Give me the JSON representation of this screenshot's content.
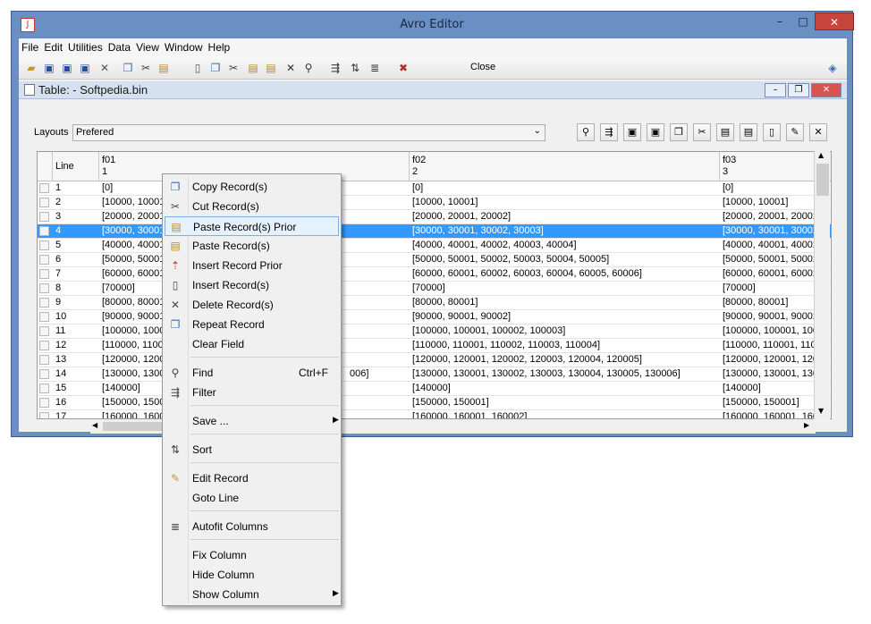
{
  "window": {
    "title": "Avro Editor"
  },
  "menu": [
    "File",
    "Edit",
    "Utilities",
    "Data",
    "View",
    "Window",
    "Help"
  ],
  "toolbar": {
    "close_label": "Close"
  },
  "inner": {
    "title": "Table: - Softpedia.bin"
  },
  "layouts": {
    "label": "Layouts",
    "value": "Prefered"
  },
  "table": {
    "line_header": "Line",
    "columns": [
      {
        "name": "f01",
        "index": "1"
      },
      {
        "name": "f02",
        "index": "2"
      },
      {
        "name": "f03",
        "index": "3"
      }
    ],
    "rows": [
      {
        "line": "1",
        "f01": "[0]",
        "f02": "[0]",
        "f03": "[0]"
      },
      {
        "line": "2",
        "f01": "[10000, 10001]",
        "f02": "[10000, 10001]",
        "f03": "[10000, 10001]"
      },
      {
        "line": "3",
        "f01": "[20000, 20001, 2",
        "f02": "[20000, 20001, 20002]",
        "f03": "[20000, 20001, 20002]"
      },
      {
        "line": "4",
        "f01": "[30000, 30001, 3",
        "f02": "[30000, 30001, 30002, 30003]",
        "f03": "[30000, 30001, 30002,",
        "selected": true
      },
      {
        "line": "5",
        "f01": "[40000, 40001, 4",
        "f02": "[40000, 40001, 40002, 40003, 40004]",
        "f03": "[40000, 40001, 40002,"
      },
      {
        "line": "6",
        "f01": "[50000, 50001, 5",
        "f02": "[50000, 50001, 50002, 50003, 50004, 50005]",
        "f03": "[50000, 50001, 50002,"
      },
      {
        "line": "7",
        "f01": "[60000, 60001, 6",
        "f02": "[60000, 60001, 60002, 60003, 60004, 60005, 60006]",
        "f03": "[60000, 60001, 60002, 6"
      },
      {
        "line": "8",
        "f01": "[70000]",
        "f02": "[70000]",
        "f03": "[70000]"
      },
      {
        "line": "9",
        "f01": "[80000, 80001]",
        "f02": "[80000, 80001]",
        "f03": "[80000, 80001]"
      },
      {
        "line": "10",
        "f01": "[90000, 90001, 9",
        "f02": "[90000, 90001, 90002]",
        "f03": "[90000, 90001, 90002]"
      },
      {
        "line": "11",
        "f01": "[100000, 100001",
        "f02": "[100000, 100001, 100002, 100003]",
        "f03": "[100000, 100001, 10000"
      },
      {
        "line": "12",
        "f01": "[110000, 110001",
        "f02": "[110000, 110001, 110002, 110003, 110004]",
        "f03": "[110000, 110001, 11000"
      },
      {
        "line": "13",
        "f01": "[120000, 120001",
        "f02": "[120000, 120001, 120002, 120003, 120004, 120005]",
        "f03": "[120000, 120001, 12000"
      },
      {
        "line": "14",
        "f01": "[130000, 130001",
        "f01_tail": "006]",
        "f02": "[130000, 130001, 130002, 130003, 130004, 130005, 130006]",
        "f03": "[130000, 130001, 13000"
      },
      {
        "line": "15",
        "f01": "[140000]",
        "f02": "[140000]",
        "f03": "[140000]"
      },
      {
        "line": "16",
        "f01": "[150000, 150001",
        "f02": "[150000, 150001]",
        "f03": "[150000, 150001]"
      },
      {
        "line": "17",
        "f01": "[160000, 160001",
        "f02": "[160000, 160001, 160002]",
        "f03": "[160000, 160001, 16000"
      }
    ]
  },
  "context_menu": {
    "copy": "Copy Record(s)",
    "cut": "Cut Record(s)",
    "paste_prior": "Paste Record(s) Prior",
    "paste": "Paste Record(s)",
    "insert_prior": "Insert Record Prior",
    "insert": "Insert Record(s)",
    "delete": "Delete Record(s)",
    "repeat": "Repeat Record",
    "clear": "Clear Field",
    "find": "Find",
    "find_shortcut": "Ctrl+F",
    "filter": "Filter",
    "save": "Save ...",
    "sort": "Sort",
    "edit": "Edit Record",
    "goto": "Goto Line",
    "autofit": "Autofit Columns",
    "fix": "Fix Column",
    "hide": "Hide Column",
    "show": "Show Column"
  },
  "colors": {
    "selection": "#3399ff",
    "titlebar": "#6a8fc3",
    "close_button": "#c7463b"
  }
}
